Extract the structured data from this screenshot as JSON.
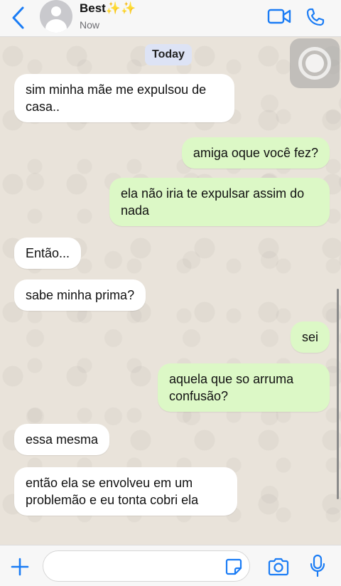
{
  "header": {
    "contact_name": "Best✨✨",
    "status": "Now"
  },
  "chat": {
    "date_label": "Today",
    "messages": [
      {
        "direction": "incoming",
        "text": "sim minha mãe me expulsou de casa.."
      },
      {
        "direction": "outgoing",
        "text": "amiga oque você fez?"
      },
      {
        "direction": "outgoing",
        "text": "ela não iria te expulsar assim do nada"
      },
      {
        "direction": "incoming",
        "text": "Então..."
      },
      {
        "direction": "incoming",
        "text": "sabe minha prima?"
      },
      {
        "direction": "outgoing",
        "text": "sei"
      },
      {
        "direction": "outgoing",
        "text": "aquela que so arruma confusão?"
      },
      {
        "direction": "incoming",
        "text": "essa mesma"
      },
      {
        "direction": "incoming",
        "text": "então ela se envolveu em um problemão e eu tonta cobri ela"
      }
    ]
  },
  "input": {
    "value": "",
    "placeholder": ""
  },
  "icons": {
    "back": "chevron-left-icon",
    "video": "video-camera-icon",
    "phone": "phone-icon",
    "plus": "plus-icon",
    "sticker": "sticker-icon",
    "camera": "camera-icon",
    "mic": "microphone-icon"
  },
  "colors": {
    "accent": "#1a7cf5",
    "outgoing_bubble": "#dcf8c6",
    "incoming_bubble": "#ffffff",
    "chat_background": "#e9e3da",
    "date_chip": "#dde3f5"
  }
}
